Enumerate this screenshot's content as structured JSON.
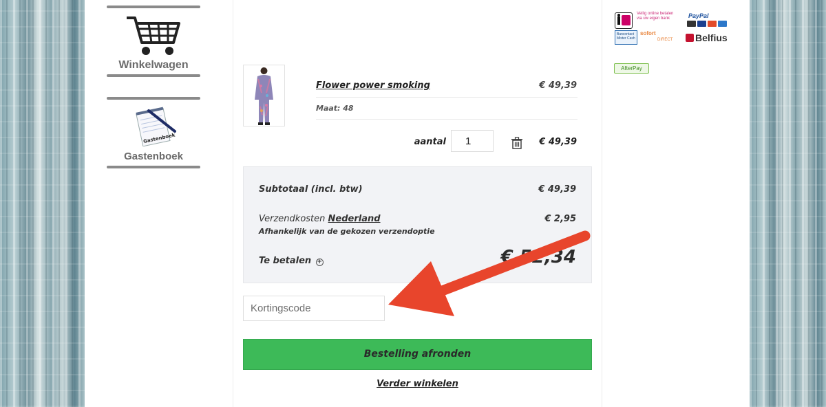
{
  "nav": {
    "cart_label": "Winkelwagen",
    "guestbook_label": "Gastenboek",
    "guestbook_notepad_text": "Gastenboek"
  },
  "cart": {
    "item": {
      "name": "Flower power smoking",
      "price": "€ 49,39",
      "size": "Maat: 48",
      "qty_label": "aantal",
      "qty_value": "1",
      "line_total": "€ 49,39"
    }
  },
  "totals": {
    "subtotal_label": "Subtotaal (incl. btw)",
    "subtotal_value": "€ 49,39",
    "shipping_label": "Verzendkosten",
    "shipping_country": "Nederland",
    "shipping_value": "€ 2,95",
    "shipping_note": "Afhankelijk van de gekozen verzendoptie",
    "pay_label": "Te betalen",
    "pay_value": "€ 52,34"
  },
  "coupon": {
    "placeholder": "Kortingscode"
  },
  "actions": {
    "checkout_label": "Bestelling afronden",
    "continue_label": "Verder winkelen"
  },
  "payment_logos": {
    "ideal_text": "Veilig online betalen via uw eigen bank",
    "paypal": "PayPal",
    "bancontact": "Bancontact Mister Cash",
    "sofort": "sofort",
    "direct": "DIRECT",
    "belfius": "Belfius",
    "afterpay": "AfterPay"
  },
  "colors": {
    "checkout_green": "#3dba58",
    "totals_bg": "#f2f3f6",
    "annotation_red": "#e8452c"
  },
  "icons": [
    "shopping-cart-icon",
    "notepad-pen-icon",
    "trash-icon",
    "plus-circle-icon",
    "red-arrow-annotation"
  ]
}
